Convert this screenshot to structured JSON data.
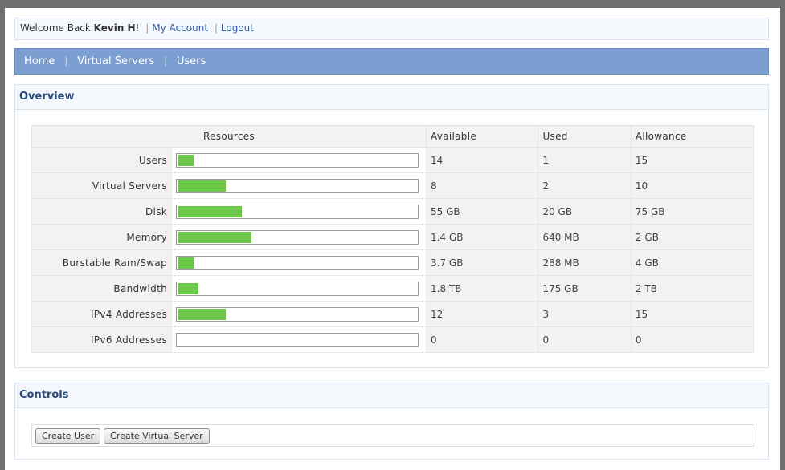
{
  "header": {
    "welcome_prefix": "Welcome Back",
    "username": "Kevin H",
    "welcome_suffix": "!",
    "my_account": "My Account",
    "logout": "Logout"
  },
  "nav": {
    "items": [
      "Home",
      "Virtual Servers",
      "Users"
    ]
  },
  "overview": {
    "title": "Overview",
    "columns": [
      "Resources",
      "Available",
      "Used",
      "Allowance"
    ],
    "rows": [
      {
        "label": "Users",
        "available": "14",
        "used": "1",
        "allowance": "15",
        "usage_fraction": 0.067
      },
      {
        "label": "Virtual Servers",
        "available": "8",
        "used": "2",
        "allowance": "10",
        "usage_fraction": 0.2
      },
      {
        "label": "Disk",
        "available": "55 GB",
        "used": "20 GB",
        "allowance": "75 GB",
        "usage_fraction": 0.267
      },
      {
        "label": "Memory",
        "available": "1.4 GB",
        "used": "640 MB",
        "allowance": "2 GB",
        "usage_fraction": 0.31
      },
      {
        "label": "Burstable Ram/Swap",
        "available": "3.7 GB",
        "used": "288 MB",
        "allowance": "4 GB",
        "usage_fraction": 0.07
      },
      {
        "label": "Bandwidth",
        "available": "1.8 TB",
        "used": "175 GB",
        "allowance": "2 TB",
        "usage_fraction": 0.086
      },
      {
        "label": "IPv4 Addresses",
        "available": "12",
        "used": "3",
        "allowance": "15",
        "usage_fraction": 0.2
      },
      {
        "label": "IPv6 Addresses",
        "available": "0",
        "used": "0",
        "allowance": "0",
        "usage_fraction": 0
      }
    ]
  },
  "controls": {
    "title": "Controls",
    "create_user": "Create User",
    "create_virtual_server": "Create Virtual Server"
  },
  "colors": {
    "bar_fill": "#6cc64a",
    "nav_bg": "#7b9fd1",
    "panel_title": "#2b4c7e",
    "link": "#2d5aa3"
  }
}
